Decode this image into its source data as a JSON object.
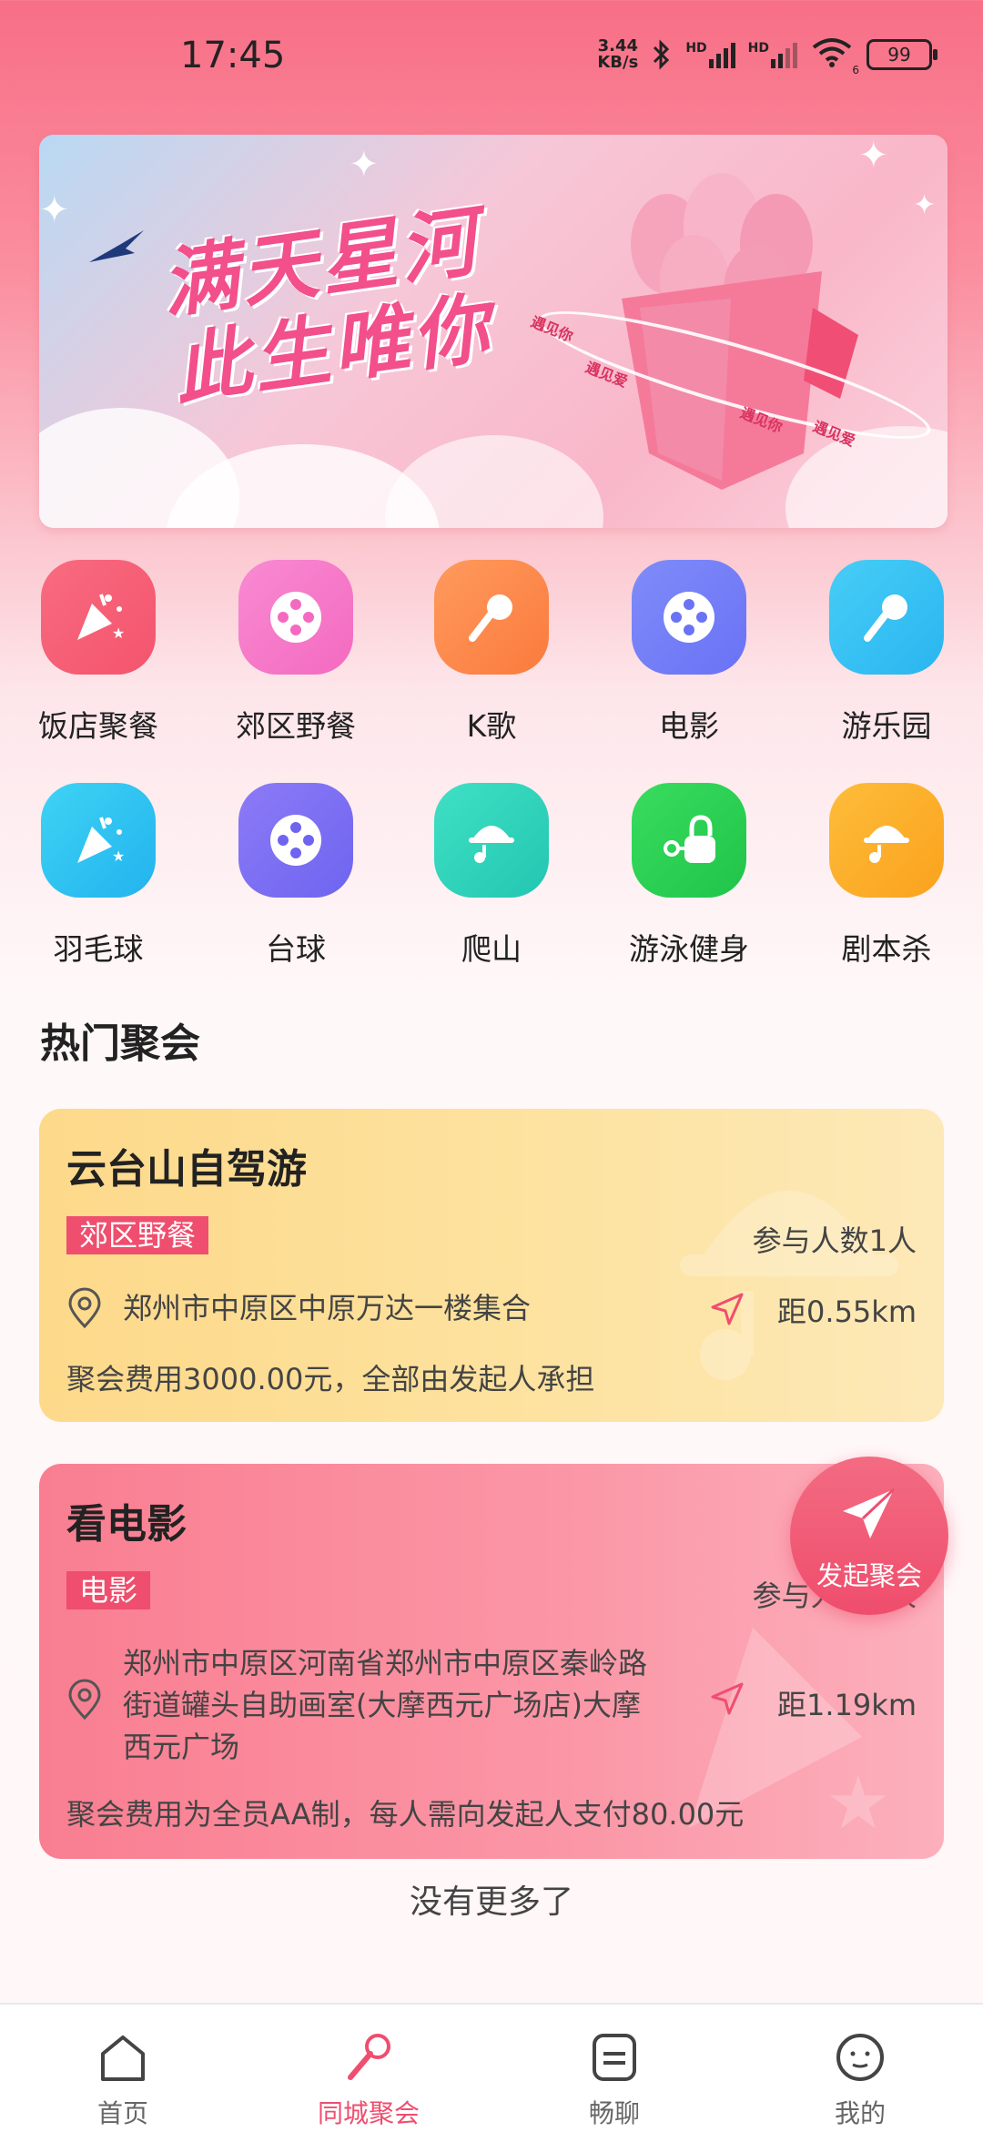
{
  "status_bar": {
    "time": "17:45",
    "net_speed_value": "3.44",
    "net_speed_unit": "KB/s",
    "sig1": "HD",
    "sig2": "HD",
    "wifi_sub": "6",
    "battery": "99"
  },
  "banner": {
    "title_line1": "满天星河",
    "title_line2": "此生唯你",
    "ribbon_1": "遇见你",
    "ribbon_2": "遇见爱",
    "ribbon_3": "遇见你",
    "ribbon_4": "遇见爱"
  },
  "categories": [
    {
      "label": "饭店聚餐",
      "color1": "#f86b80",
      "color2": "#f4546d",
      "icon": "party-popper-icon"
    },
    {
      "label": "郊区野餐",
      "color1": "#f98ad2",
      "color2": "#f36ac0",
      "icon": "film-reel-icon"
    },
    {
      "label": "K歌",
      "color1": "#ff9a5d",
      "color2": "#fb7a3d",
      "icon": "microphone-icon"
    },
    {
      "label": "电影",
      "color1": "#7f8cf9",
      "color2": "#6a72f5",
      "icon": "film-reel-icon"
    },
    {
      "label": "游乐园",
      "color1": "#47cdf6",
      "color2": "#29b5f0",
      "icon": "microphone-icon"
    },
    {
      "label": "羽毛球",
      "color1": "#3fd3f4",
      "color2": "#22b3ee",
      "icon": "party-popper-icon"
    },
    {
      "label": "台球",
      "color1": "#8c7bf6",
      "color2": "#6e64f0",
      "icon": "film-reel-icon"
    },
    {
      "label": "爬山",
      "color1": "#3fe0c4",
      "color2": "#23c6b1",
      "icon": "music-hat-icon"
    },
    {
      "label": "游泳健身",
      "color1": "#39dc5d",
      "color2": "#1fc44a",
      "icon": "lock-key-icon"
    },
    {
      "label": "剧本杀",
      "color1": "#fdbd3a",
      "color2": "#fba21d",
      "icon": "music-hat-icon"
    }
  ],
  "section": {
    "title": "热门聚会"
  },
  "events": [
    {
      "title": "云台山自驾游",
      "tag": "郊区野餐",
      "participants": "参与人数1人",
      "address": "郑州市中原区中原万达一楼集合",
      "distance": "距0.55km",
      "fee": "聚会费用3000.00元，全部由发起人承担"
    },
    {
      "title": "看电影",
      "tag": "电影",
      "participants": "参与人数1人",
      "address_line1": "郑州市中原区河南省郑州市中原区秦岭路",
      "address_line2": "街道罐头自助画室(大摩西元广场店)大摩",
      "address_line3": "西元广场",
      "distance": "距1.19km",
      "fee": "聚会费用为全员AA制，每人需向发起人支付80.00元"
    }
  ],
  "fab": {
    "label": "发起聚会"
  },
  "footer": {
    "no_more": "没有更多了"
  },
  "tabs": [
    {
      "label": "首页"
    },
    {
      "label": "同城聚会"
    },
    {
      "label": "畅聊"
    },
    {
      "label": "我的"
    }
  ],
  "colors": {
    "accent": "#ef4e6e"
  }
}
